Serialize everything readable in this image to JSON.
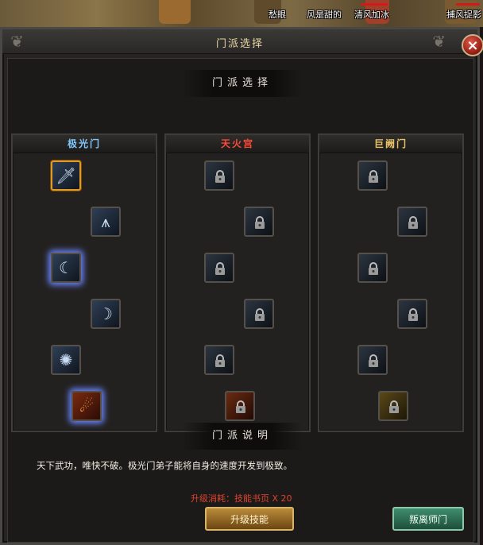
{
  "scene": {
    "players": [
      {
        "name": "愁眼"
      },
      {
        "name": "风是甜的"
      },
      {
        "name": "清风加冰"
      },
      {
        "name": "捕风捉影"
      }
    ]
  },
  "window": {
    "title": "门派选择",
    "close_glyph": "×"
  },
  "sections": {
    "select_title": "门派选择",
    "description_title": "门派说明"
  },
  "sects": [
    {
      "name": "极光门",
      "color": "#7fc8ff",
      "skills": [
        {
          "icon": "sword-icon",
          "state": "selected"
        },
        {
          "icon": "ice-spike-icon",
          "state": "unlocked"
        },
        {
          "icon": "crescent-slash-icon",
          "state": "unlocked-glow"
        },
        {
          "icon": "crescent-moon-icon",
          "state": "unlocked"
        },
        {
          "icon": "dash-strike-icon",
          "state": "unlocked"
        },
        {
          "icon": "fire-blast-icon",
          "state": "unlocked-glow"
        }
      ]
    },
    {
      "name": "天火宫",
      "color": "#ff4a3a",
      "skills": [
        {
          "icon": "sword-icon",
          "state": "locked"
        },
        {
          "icon": "ice-spike-icon",
          "state": "locked"
        },
        {
          "icon": "crescent-slash-icon",
          "state": "locked"
        },
        {
          "icon": "crescent-moon-icon",
          "state": "locked"
        },
        {
          "icon": "dash-strike-icon",
          "state": "locked"
        },
        {
          "icon": "fire-blast-icon",
          "state": "locked"
        }
      ]
    },
    {
      "name": "巨阙门",
      "color": "#e9c36a",
      "skills": [
        {
          "icon": "sword-icon",
          "state": "locked"
        },
        {
          "icon": "ice-spike-icon",
          "state": "locked"
        },
        {
          "icon": "crescent-slash-icon",
          "state": "locked"
        },
        {
          "icon": "crescent-moon-icon",
          "state": "locked"
        },
        {
          "icon": "dash-strike-icon",
          "state": "locked"
        },
        {
          "icon": "golden-aura-icon",
          "state": "locked"
        }
      ]
    }
  ],
  "description": "天下武功，唯快不破。极光门弟子能将自身的速度开发到极致。",
  "cost": "升级消耗：技能书页 X 20",
  "buttons": {
    "upgrade": "升级技能",
    "leave": "叛离师门"
  },
  "colors": {
    "accent_gold": "#e49a22",
    "cost_red": "#e0432f",
    "title_gold": "#e8d7a6"
  }
}
